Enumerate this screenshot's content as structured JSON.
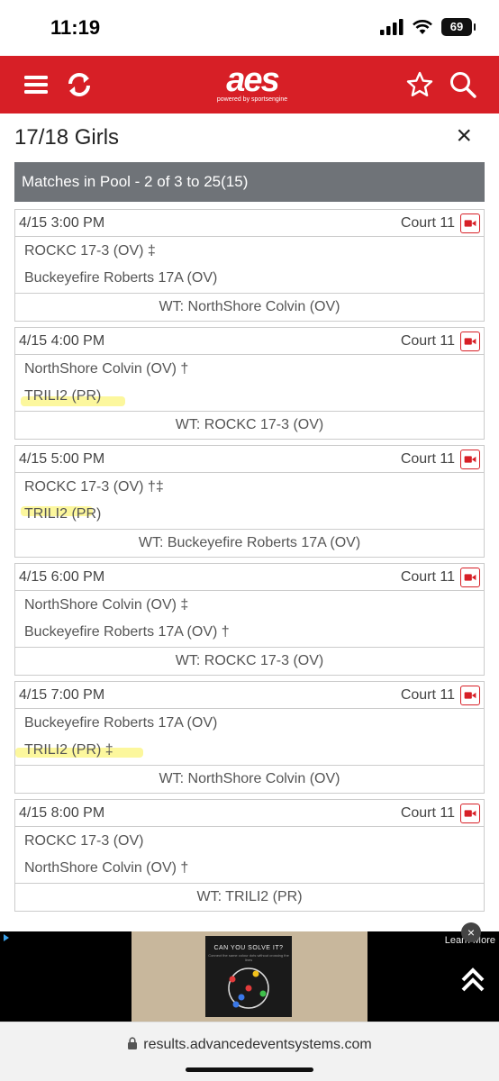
{
  "status": {
    "time": "11:19",
    "battery": "69"
  },
  "app": {
    "logo_main": "aes",
    "logo_sub": "powered by sportsengine",
    "icons": [
      "menu-icon",
      "refresh-icon",
      "star-icon",
      "search-icon"
    ],
    "accent": "#d71f26"
  },
  "page": {
    "title": "17/18 Girls",
    "close": "×"
  },
  "pool": {
    "header": "Matches in Pool - 2 of 3 to 25(15)"
  },
  "matches": [
    {
      "date": "4/15 3:00 PM",
      "court": "Court 11",
      "team1": "ROCKC 17-3 (OV) ‡",
      "team2": "Buckeyefire Roberts 17A (OV)",
      "wt": "WT: NorthShore Colvin (OV)"
    },
    {
      "date": "4/15 4:00 PM",
      "court": "Court 11",
      "team1": "NorthShore Colvin (OV) †",
      "team2": "TRILI2 (PR)",
      "wt": "WT: ROCKC 17-3 (OV)"
    },
    {
      "date": "4/15 5:00 PM",
      "court": "Court 11",
      "team1": "ROCKC 17-3 (OV) †‡",
      "team2": "TRILI2 (PR)",
      "wt": "WT: Buckeyefire Roberts 17A (OV)"
    },
    {
      "date": "4/15 6:00 PM",
      "court": "Court 11",
      "team1": "NorthShore Colvin (OV) ‡",
      "team2": "Buckeyefire Roberts 17A (OV) †",
      "wt": "WT: ROCKC 17-3 (OV)"
    },
    {
      "date": "4/15 7:00 PM",
      "court": "Court 11",
      "team1": "Buckeyefire Roberts 17A (OV)",
      "team2": "TRILI2 (PR) ‡",
      "wt": "WT: NorthShore Colvin (OV)"
    },
    {
      "date": "4/15 8:00 PM",
      "court": "Court 11",
      "team1": "ROCKC 17-3 (OV)",
      "team2": "NorthShore Colvin (OV) †",
      "wt": "WT: TRILI2 (PR)"
    }
  ],
  "ad": {
    "learn_more": "Learn More",
    "close": "×",
    "card_title": "CAN YOU SOLVE IT?",
    "card_sub": "Connect the same colour dots without crossing the lines"
  },
  "browser": {
    "url": "results.advancedeventsystems.com"
  }
}
